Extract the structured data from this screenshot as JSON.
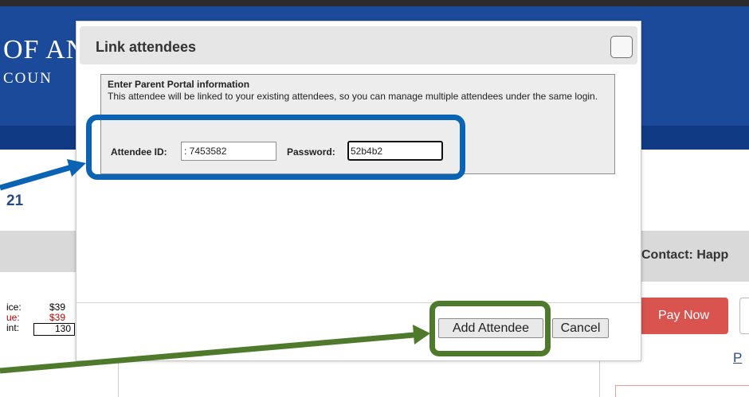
{
  "background_page": {
    "header_title_line1": "OF AN",
    "header_title_line2": "COUN",
    "year_fragment": "21",
    "contact_label": "Contact: Happ",
    "summary": [
      {
        "label": "ice:",
        "value": "$39",
        "color": "#000000"
      },
      {
        "label": "ue:",
        "value": "$39",
        "color": "#c00000"
      },
      {
        "label": "int:",
        "value": "130",
        "color": "#000000"
      }
    ],
    "pay_now_label": "Pay Now",
    "link_fragment": "P"
  },
  "modal": {
    "title": "Link attendees",
    "portal_heading": "Enter Parent Portal information",
    "portal_description": "This attendee will be linked to your existing attendees, so you can manage multiple attendees under the same login.",
    "attendee_id_label": "Attendee ID:",
    "attendee_id_value": ": 7453582",
    "password_label": "Password:",
    "password_value": "52b4b2",
    "add_attendee_label": "Add Attendee",
    "cancel_label": "Cancel"
  },
  "colors": {
    "header_blue": "#1c4a9a",
    "pay_now_red": "#d9534f",
    "highlight_blue": "#0a63b3",
    "highlight_green": "#4f7a2b"
  }
}
